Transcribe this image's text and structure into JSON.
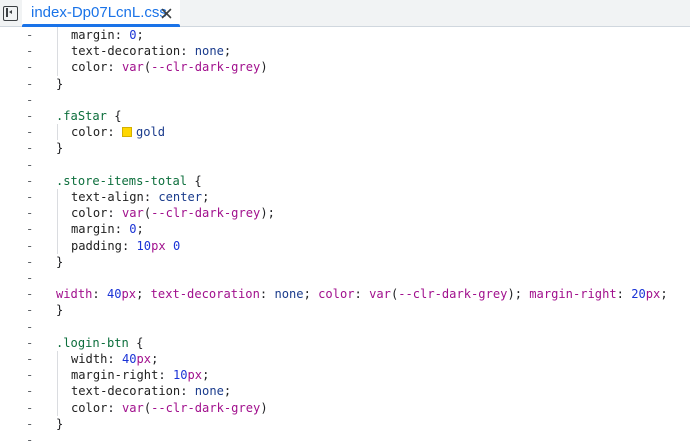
{
  "tab": {
    "filename": "index-Dp07LcnL.css"
  },
  "colors": {
    "tab_active": "#1a73e8",
    "swatch_gold": "#ffd700"
  },
  "icons": {
    "sidebar_toggle": "sidebar-toggle-icon",
    "close": "close-icon"
  },
  "lines": [
    {
      "mark": "-",
      "text": "margin: 0;"
    },
    {
      "mark": "-",
      "text": "text-decoration: none;"
    },
    {
      "mark": "-",
      "text": "color: var(--clr-dark-grey)"
    },
    {
      "mark": "-",
      "text": "}"
    },
    {
      "mark": "-",
      "text": ""
    },
    {
      "mark": "-",
      "text": ".faStar {"
    },
    {
      "mark": "-",
      "text": "color: gold"
    },
    {
      "mark": "-",
      "text": "}"
    },
    {
      "mark": "-",
      "text": ""
    },
    {
      "mark": "-",
      "text": ".store-items-total {"
    },
    {
      "mark": "-",
      "text": "text-align: center;"
    },
    {
      "mark": "-",
      "text": "color: var(--clr-dark-grey);"
    },
    {
      "mark": "-",
      "text": "margin: 0;"
    },
    {
      "mark": "-",
      "text": "padding: 10px 0"
    },
    {
      "mark": "-",
      "text": "}"
    },
    {
      "mark": "-",
      "text": ""
    },
    {
      "mark": "-",
      "text": "width: 40px; text-decoration: none; color: var(--clr-dark-grey); margin-right: 20px;"
    },
    {
      "mark": "-",
      "text": "}"
    },
    {
      "mark": "-",
      "text": ""
    },
    {
      "mark": "-",
      "text": ".login-btn {"
    },
    {
      "mark": "-",
      "text": "width: 40px;"
    },
    {
      "mark": "-",
      "text": "margin-right: 10px;"
    },
    {
      "mark": "-",
      "text": "text-decoration: none;"
    },
    {
      "mark": "-",
      "text": "color: var(--clr-dark-grey)"
    },
    {
      "mark": "-",
      "text": "}"
    },
    {
      "mark": "-",
      "text": ""
    }
  ]
}
